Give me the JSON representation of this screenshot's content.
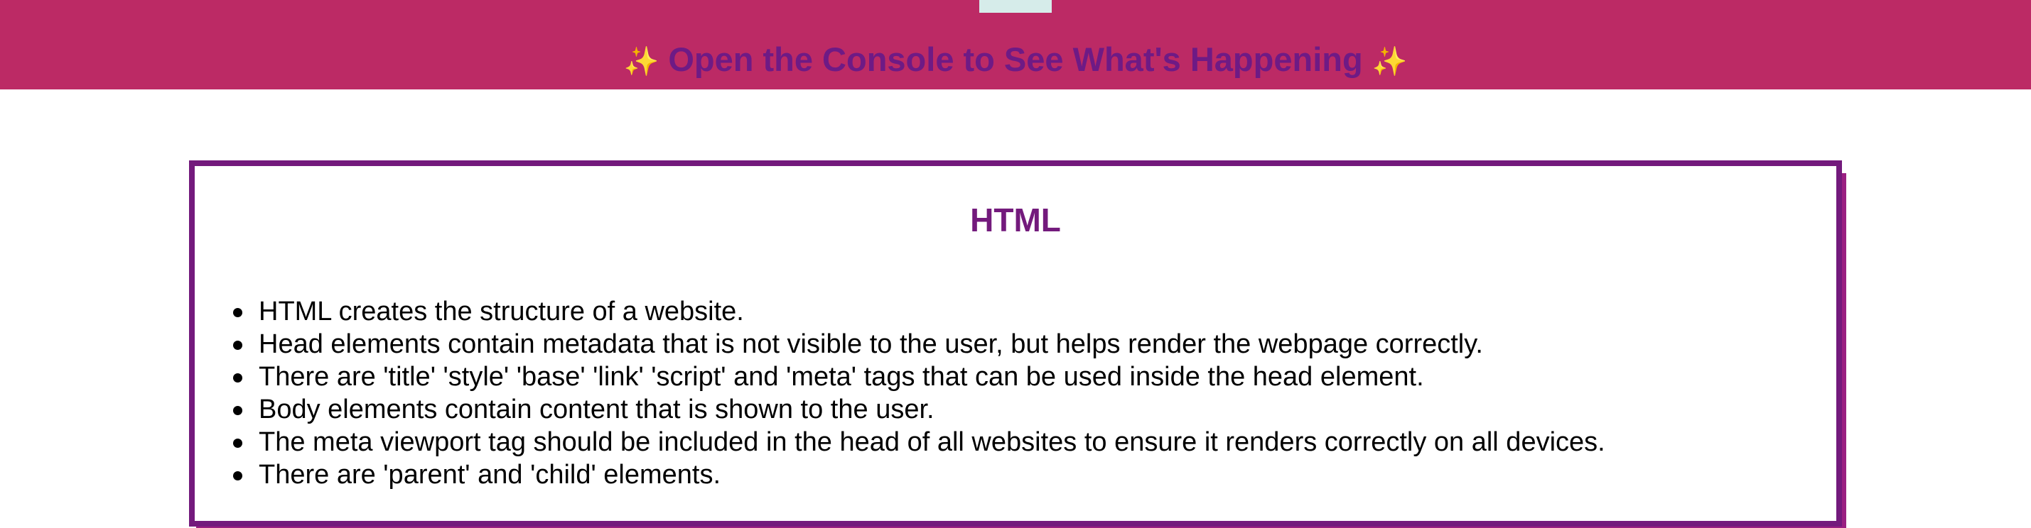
{
  "banner": {
    "sparkle_left": "✨",
    "title": "Open the Console to See What's Happening",
    "sparkle_right": "✨"
  },
  "card": {
    "title": "HTML",
    "items": [
      "HTML creates the structure of a website.",
      "Head elements contain metadata that is not visible to the user, but helps render the webpage correctly.",
      "There are 'title' 'style' 'base' 'link' 'script' and 'meta' tags that can be used inside the head element.",
      "Body elements contain content that is shown to the user.",
      "The meta viewport tag should be included in the head of all websites to ensure it renders correctly on all devices.",
      "There are 'parent' and 'child' elements."
    ]
  },
  "colors": {
    "banner_background": "#bc2a65",
    "banner_text": "#6e1a85",
    "sparkle": "#f2d14f",
    "card_border": "#731a7c",
    "card_shadow": "#9b1f82",
    "card_title": "#731a7c"
  }
}
